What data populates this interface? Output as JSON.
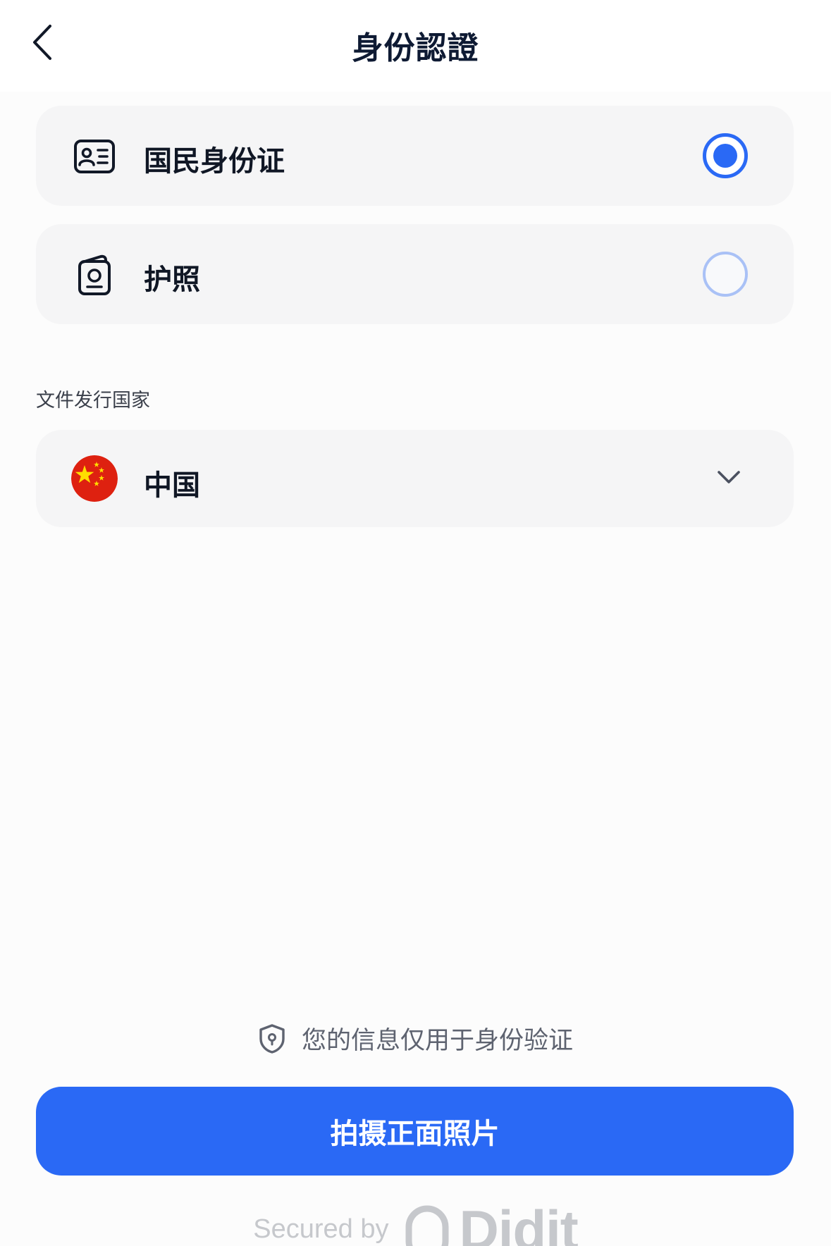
{
  "header": {
    "title": "身份認證",
    "back_icon": "chevron-left-icon"
  },
  "document_types": [
    {
      "label": "国民身份证",
      "icon": "id-card-icon",
      "selected": true
    },
    {
      "label": "护照",
      "icon": "passport-icon",
      "selected": false
    }
  ],
  "country": {
    "section_label": "文件发行国家",
    "selected_value": "中国",
    "flag_icon": "china-flag-icon",
    "dropdown_icon": "chevron-down-icon"
  },
  "footer": {
    "privacy_text": "您的信息仅用于身份验证",
    "privacy_icon": "shield-icon",
    "primary_button_label": "拍摄正面照片",
    "secured_by": "Secured by",
    "brand_name": "Didit"
  },
  "colors": {
    "accent": "#2a69f5",
    "card_background": "#f5f5f6",
    "radio_unselected_border": "#a9c1f6",
    "title_text": "#0e1a33"
  }
}
